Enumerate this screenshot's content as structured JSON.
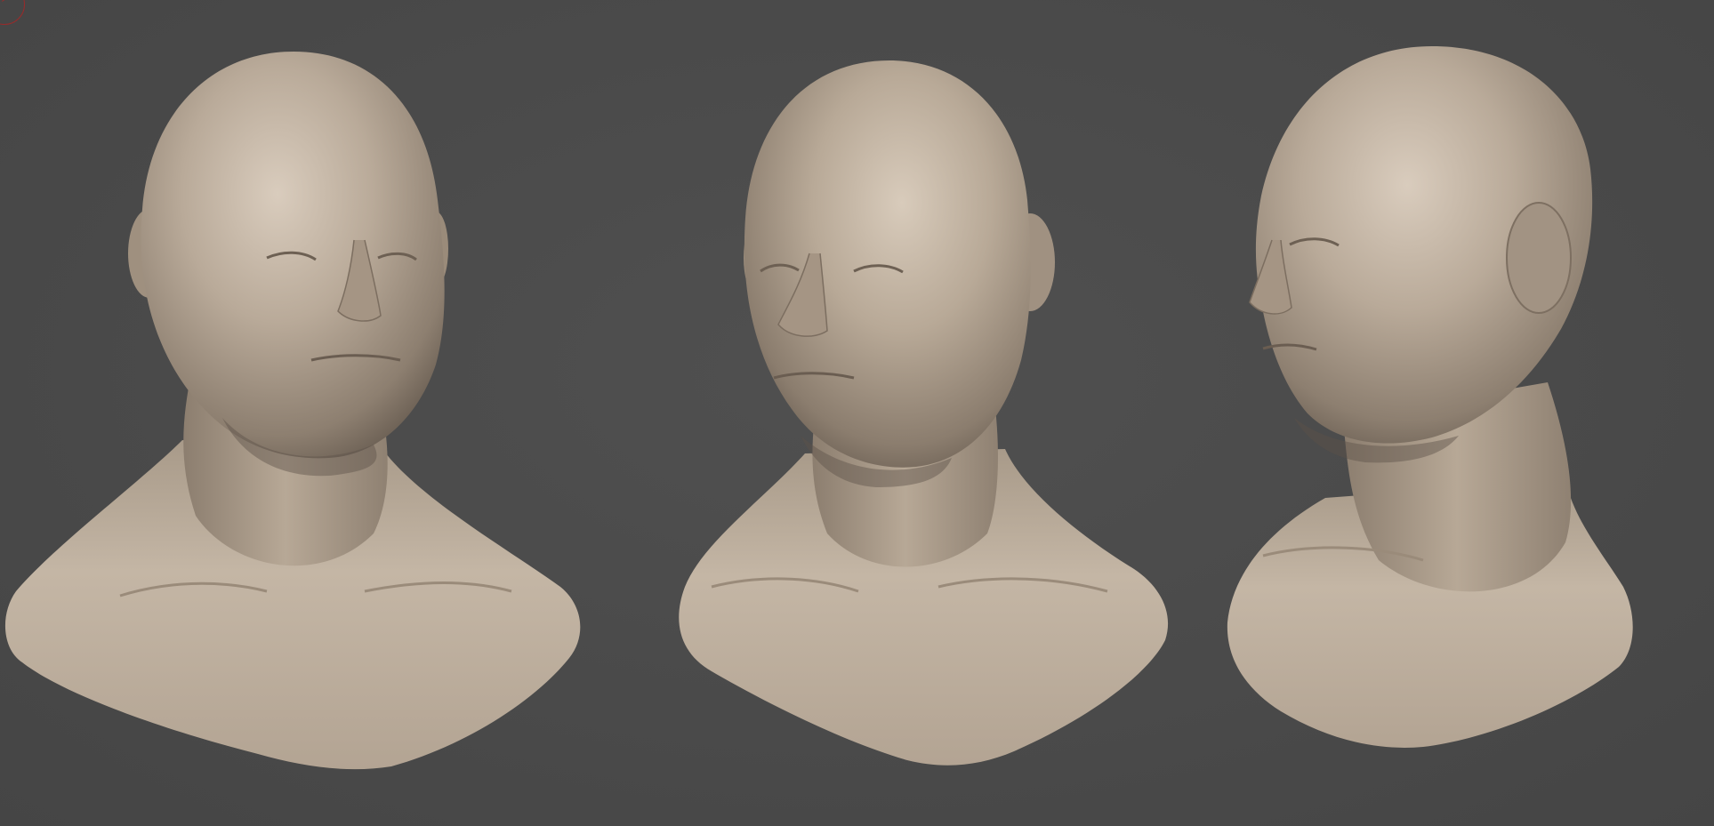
{
  "viewport": {
    "background_color": "#4a4a4a",
    "material_color": "#b8a998"
  },
  "models": [
    {
      "view": "front-three-quarter-left"
    },
    {
      "view": "front-three-quarter-right"
    },
    {
      "view": "side-three-quarter-left"
    }
  ]
}
